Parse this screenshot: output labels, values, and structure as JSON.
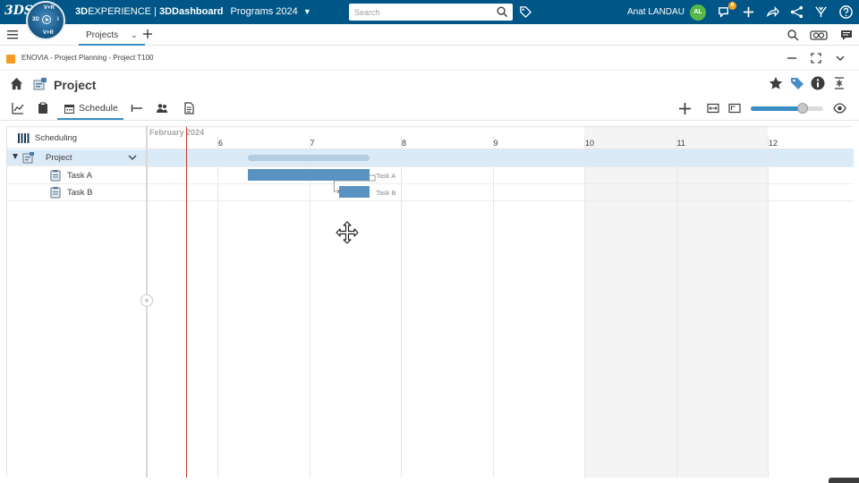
{
  "topbar": {
    "brand": "3DS",
    "compass_labels": {
      "top": "V+R",
      "left": "3D",
      "right": "i",
      "bottom": "V+R"
    },
    "app_title_brand": "3D",
    "app_title_rest": "EXPERIENCE | ",
    "app_title_dashboard": "3DDashboard",
    "dashboard_name": "Programs 2024",
    "search_placeholder": "Search",
    "user_name": "Anat LANDAU",
    "avatar_initials": "AL",
    "notification_count": "6"
  },
  "tabbar": {
    "active_tab": "Projects"
  },
  "widget": {
    "title": "ENOVIA - Project Planning - Project T100"
  },
  "page": {
    "title": "Project"
  },
  "toolbar": {
    "active_view": "Schedule",
    "zoom_level": 0.71
  },
  "gantt": {
    "left_header": "Scheduling",
    "rows": [
      {
        "label": "Project",
        "type": "summary"
      },
      {
        "label": "Task A",
        "type": "task"
      },
      {
        "label": "Task B",
        "type": "task"
      }
    ],
    "timeline": {
      "month": "February 2024",
      "days": [
        "6",
        "7",
        "8",
        "9",
        "10",
        "11",
        "12"
      ],
      "weekend_days": [
        "10",
        "11"
      ]
    },
    "bars": [
      {
        "row": "Project",
        "start": 6.33,
        "end": 7.66
      },
      {
        "row": "Task A",
        "start": 6.33,
        "end": 7.66,
        "label": "Task A"
      },
      {
        "row": "Task B",
        "start": 7.33,
        "end": 7.66,
        "label": "Task B"
      }
    ],
    "today": 5.66
  }
}
